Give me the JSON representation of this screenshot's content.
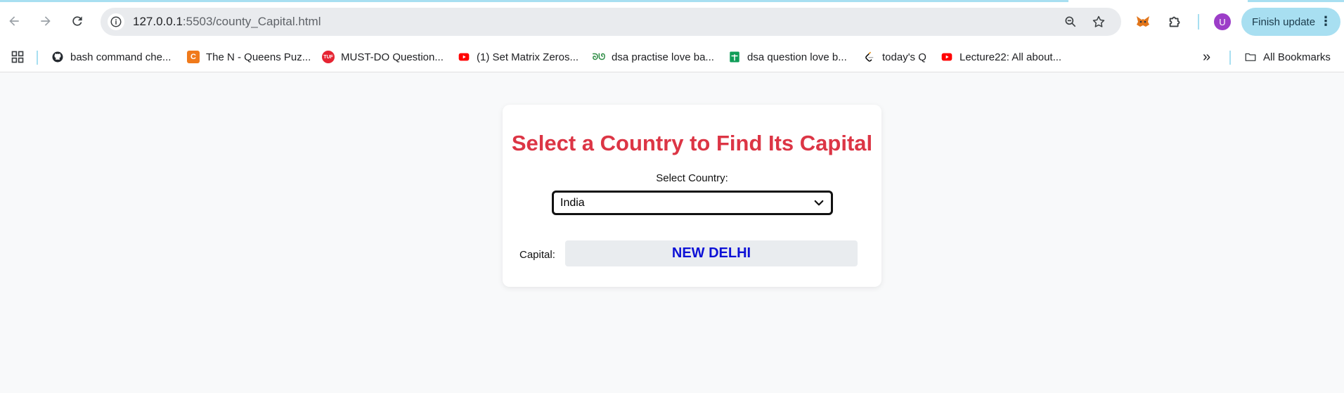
{
  "browser": {
    "url_host": "127.0.0.1",
    "url_rest": ":5503/county_Capital.html",
    "profile_initial": "U",
    "finish_update_label": "Finish update",
    "menu_dots": "⋮"
  },
  "bookmarks": {
    "items": [
      {
        "label": "bash command che...",
        "icon": "github-icon"
      },
      {
        "label": "The N - Queens Puz...",
        "icon": "codechef-icon"
      },
      {
        "label": "MUST-DO Question...",
        "icon": "tuf-icon"
      },
      {
        "label": "(1) Set Matrix Zeros...",
        "icon": "youtube-icon"
      },
      {
        "label": "dsa practise love ba...",
        "icon": "gfg-icon"
      },
      {
        "label": "dsa question love b...",
        "icon": "sheets-icon"
      },
      {
        "label": "today's Q",
        "icon": "leetcode-icon"
      },
      {
        "label": "Lecture22: All about...",
        "icon": "youtube-icon"
      }
    ],
    "more_label": "»",
    "all_bookmarks_label": "All Bookmarks"
  },
  "page": {
    "heading": "Select a Country to Find Its Capital",
    "select_label": "Select Country:",
    "selected_country": "India",
    "capital_label": "Capital:",
    "capital_value": "NEW DELHI"
  },
  "colors": {
    "heading": "#dc3545",
    "capital_value": "#0d11d6",
    "accent": "#a8dff1"
  }
}
